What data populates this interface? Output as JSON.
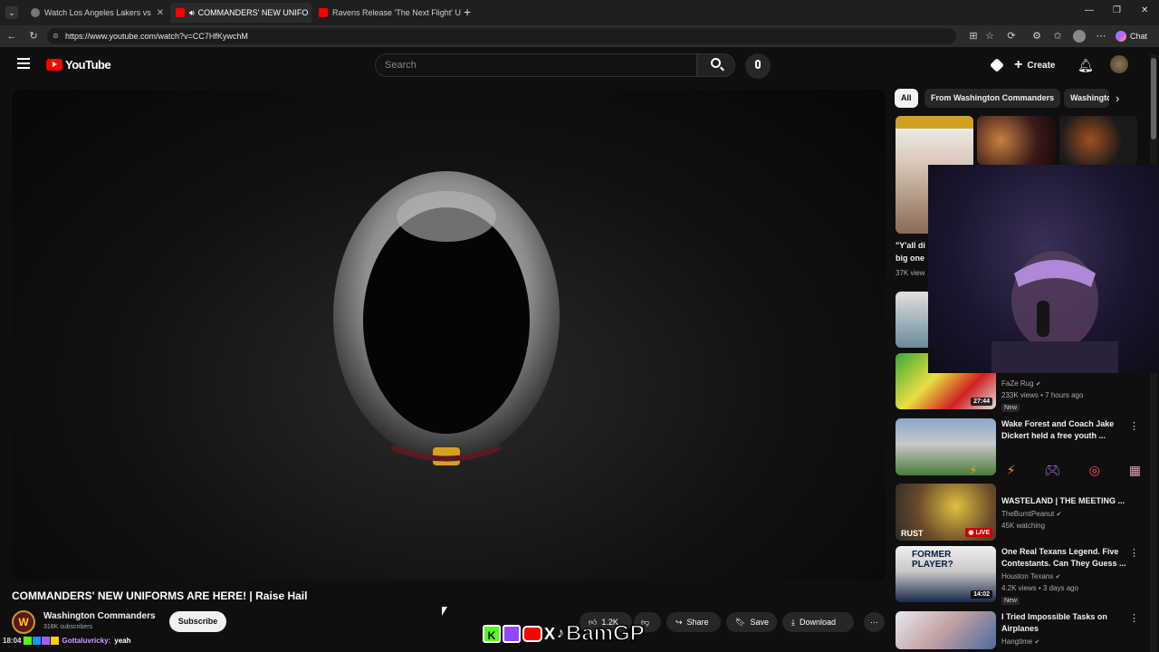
{
  "browser": {
    "tabs": [
      {
        "title": "Watch Los Angeles Lakers vs"
      },
      {
        "title": "COMMANDERS' NEW UNIFO"
      },
      {
        "title": "Ravens Release 'The Next Flight' U"
      }
    ],
    "url": "https://www.youtube.com/watch?v=CC7HfKywchM",
    "chat_label": "Chat"
  },
  "yt": {
    "logo": "YouTube",
    "search_placeholder": "Search",
    "create_label": "Create"
  },
  "video": {
    "title": "COMMANDERS' NEW UNIFORMS ARE HERE! | Raise Hail",
    "channel": "Washington Commanders",
    "subscribers": "318K subscribers",
    "subscribe_label": "Subscribe",
    "likes": "1.2K",
    "share_label": "Share",
    "save_label": "Save",
    "download_label": "Download"
  },
  "chips": [
    "All",
    "From Washington Commanders",
    "Washington"
  ],
  "recommendations": [
    {
      "title": "\"Y'all di",
      "title2": "big one",
      "meta": "37K view"
    },
    {
      "channel": "FaZe Rug",
      "meta": "233K views • 7 hours ago",
      "badge": "New",
      "duration": "27:44"
    },
    {
      "title": "Wake Forest and Coach Jake Dickert held a free youth ...",
      "title_l1": "Wake Forest and Coach Jake",
      "title_l2": "Dickert held a free youth ..."
    },
    {
      "title": "WASTELAND | THE MEETING ...",
      "channel": "TheBurntPeanut",
      "meta": "45K watching",
      "live": "LIVE",
      "thumb_text": "RUST"
    },
    {
      "title_l1": "One Real Texans Legend. Five",
      "title_l2": "Contestants. Can They Guess ...",
      "channel": "Houston Texans",
      "meta": "4.2K views • 3 days ago",
      "badge": "New",
      "duration": "14:02",
      "thumb_text": "FORMER PLAYER?"
    },
    {
      "title_l1": "I Tried Impossible Tasks on",
      "title_l2": "Airplanes",
      "channel": "Hangtime"
    }
  ],
  "overlay": {
    "time": "18:04",
    "chat_user": "Gottaluvricky:",
    "chat_msg": "yeah",
    "streamer_tag": "BamGP"
  },
  "colors": {
    "yt_red": "#ff0000",
    "bg": "#0f0f0f",
    "chat_user": "#c9a0ff"
  }
}
